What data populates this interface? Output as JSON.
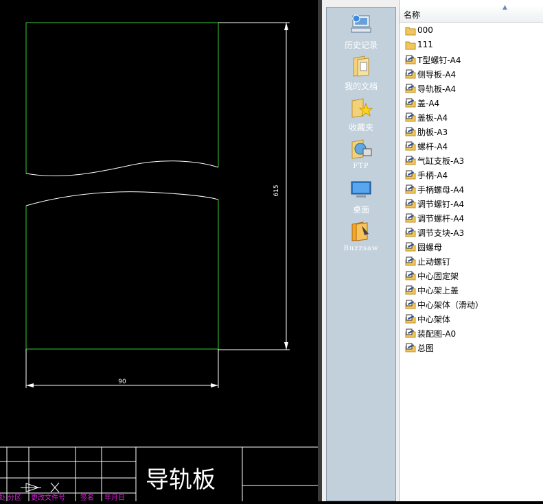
{
  "drawing": {
    "dimension_vertical": "615",
    "dimension_horizontal": "90",
    "title_block_text": "导轨板",
    "title_row_labels": [
      "处 分区",
      "更改文件号",
      "签名",
      "年月日"
    ]
  },
  "places": [
    {
      "label": "历史记录",
      "icon": "history-icon"
    },
    {
      "label": "我的文档",
      "icon": "my-documents-icon"
    },
    {
      "label": "收藏夹",
      "icon": "favorites-icon"
    },
    {
      "label": "FTP",
      "icon": "ftp-icon"
    },
    {
      "label": "桌面",
      "icon": "desktop-icon"
    },
    {
      "label": "Buzzsaw",
      "icon": "buzzsaw-icon"
    }
  ],
  "filelist": {
    "column_header": "名称",
    "items": [
      {
        "name": "000",
        "type": "folder"
      },
      {
        "name": "111",
        "type": "folder"
      },
      {
        "name": "T型螺钉-A4",
        "type": "dwg"
      },
      {
        "name": "侧导板-A4",
        "type": "dwg"
      },
      {
        "name": "导轨板-A4",
        "type": "dwg"
      },
      {
        "name": "盖-A4",
        "type": "dwg"
      },
      {
        "name": "盖板-A4",
        "type": "dwg"
      },
      {
        "name": "肋板-A3",
        "type": "dwg"
      },
      {
        "name": "螺杆-A4",
        "type": "dwg"
      },
      {
        "name": "气缸支板-A3",
        "type": "dwg"
      },
      {
        "name": "手柄-A4",
        "type": "dwg"
      },
      {
        "name": "手柄螺母-A4",
        "type": "dwg"
      },
      {
        "name": "调节螺钉-A4",
        "type": "dwg"
      },
      {
        "name": "调节螺杆-A4",
        "type": "dwg"
      },
      {
        "name": "调节支块-A3",
        "type": "dwg"
      },
      {
        "name": "圆螺母",
        "type": "dwg"
      },
      {
        "name": "止动螺钉",
        "type": "dwg"
      },
      {
        "name": "中心固定架",
        "type": "dwg"
      },
      {
        "name": "中心架上盖",
        "type": "dwg"
      },
      {
        "name": "中心架体（滑动）",
        "type": "dwg"
      },
      {
        "name": "中心架体",
        "type": "dwg"
      },
      {
        "name": "装配图-A0",
        "type": "dwg"
      },
      {
        "name": "总图",
        "type": "dwg"
      }
    ]
  },
  "colors": {
    "part_outline": "#33cc33",
    "dimension": "#ffffff",
    "title_labels": "#e020e0",
    "places_bg": "#c2d0dc"
  }
}
